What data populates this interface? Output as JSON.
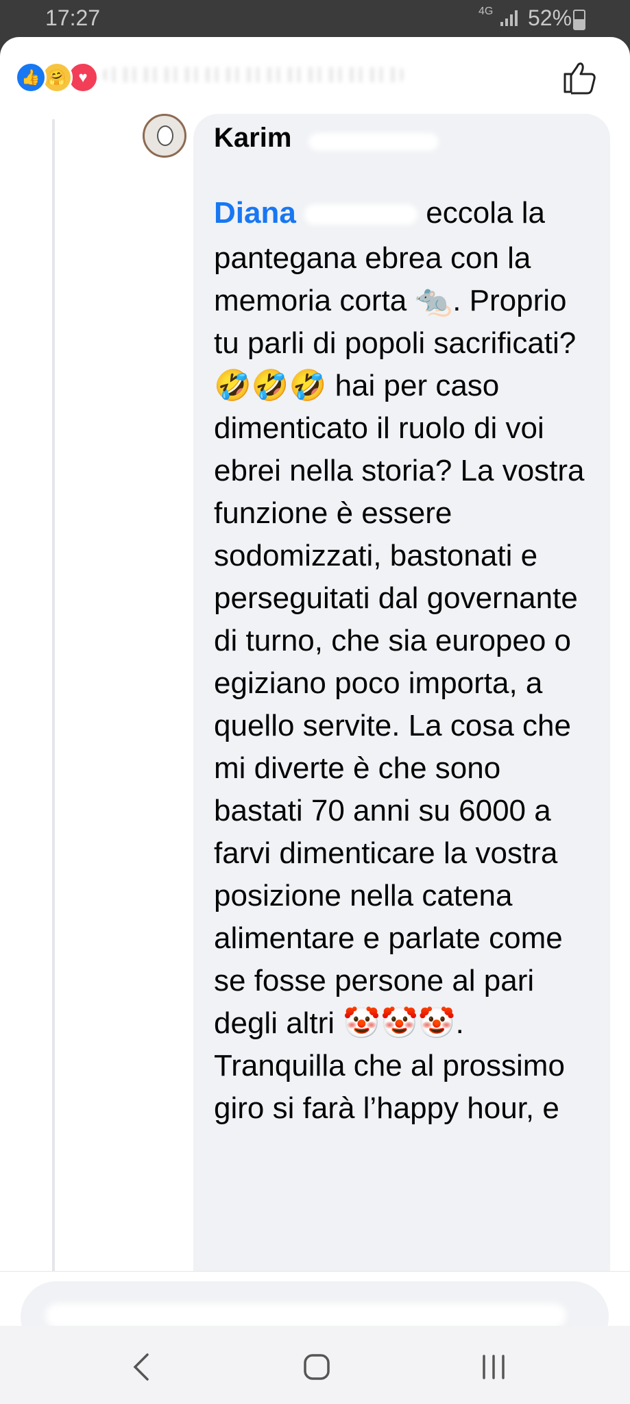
{
  "status_bar": {
    "time": "17:27",
    "network": "4G",
    "battery": "52%"
  },
  "reactions": [
    "like-icon",
    "care-icon",
    "love-icon"
  ],
  "comment": {
    "author": "Karim",
    "mention": "Diana",
    "first_line_rest": "eccola la",
    "body": "pantegana ebrea con la memoria corta 🐀. Proprio tu parli di popoli sacrificati? 🤣🤣🤣 hai per caso dimenticato il ruolo di voi ebrei nella storia? La vostra funzione è essere sodomizzati, bastonati e perseguitati dal governante di turno, che sia europeo o egiziano poco importa, a quello servite. La cosa che mi diverte è che sono bastati 70 anni su 6000 a farvi dimenticare la vostra posizione nella catena alimentare e parlate come se fosse persone al pari degli altri 🤡🤡🤡. Tranquilla che al prossimo giro si farà l’happy hour, e"
  },
  "colors": {
    "facebook_blue": "#1877f2",
    "bubble_bg": "#f0f2f5",
    "love_red": "#f33e58"
  }
}
